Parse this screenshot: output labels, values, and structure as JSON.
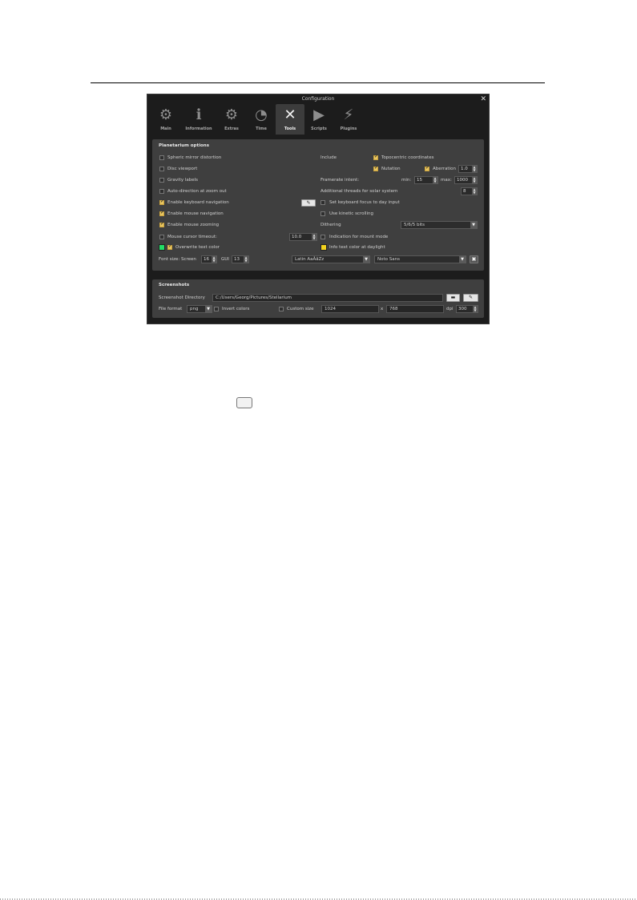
{
  "window": {
    "title": "Configuration",
    "close_glyph": "✕",
    "tabs": [
      {
        "label": "Main",
        "icon": "gear-icon",
        "glyph": "⚙"
      },
      {
        "label": "Information",
        "icon": "info-icon",
        "glyph": "ℹ"
      },
      {
        "label": "Extras",
        "icon": "extras-icon",
        "glyph": "⚙"
      },
      {
        "label": "Time",
        "icon": "clock-icon",
        "glyph": "◔"
      },
      {
        "label": "Tools",
        "icon": "tools-icon",
        "glyph": "✕"
      },
      {
        "label": "Scripts",
        "icon": "play-icon",
        "glyph": "▶"
      },
      {
        "label": "Plugins",
        "icon": "plug-icon",
        "glyph": "⚡"
      }
    ],
    "active_tab": "Tools"
  },
  "planetarium": {
    "title": "Planetarium options",
    "spheric_mirror": {
      "label": "Spheric mirror distortion",
      "checked": false
    },
    "disc_viewport": {
      "label": "Disc viewport",
      "checked": false
    },
    "gravity_labels": {
      "label": "Gravity labels",
      "checked": false
    },
    "auto_direction": {
      "label": "Auto-direction at zoom out",
      "checked": false
    },
    "keyboard_nav": {
      "label": "Enable keyboard navigation",
      "checked": true
    },
    "mouse_nav": {
      "label": "Enable mouse navigation",
      "checked": true
    },
    "mouse_zoom": {
      "label": "Enable mouse zooming",
      "checked": true
    },
    "mouse_timeout": {
      "label": "Mouse cursor timeout:",
      "checked": false,
      "value": "10.0"
    },
    "overwrite_color": {
      "label": "Overwrite text color",
      "checked": true,
      "color": "#22dd66"
    },
    "font_size": {
      "label": "Font size: Screen",
      "screen_value": "16",
      "gui_label": "GUI",
      "gui_value": "13"
    },
    "script_combo": "Latin  AaÂâZz",
    "include_label": "Include",
    "topocentric": {
      "label": "Topocentric coordinates",
      "checked": true
    },
    "nutation": {
      "label": "Nutation",
      "checked": true
    },
    "aberration": {
      "label": "Aberration",
      "checked": true,
      "value": "1.0"
    },
    "framerate": {
      "label": "Framerate intent:",
      "min_label": "min:",
      "min_value": "15",
      "max_label": "max:",
      "max_value": "1000"
    },
    "threads": {
      "label": "Additional threads for solar system",
      "value": "8"
    },
    "focus_day": {
      "label": "Set keyboard focus to day input",
      "checked": false
    },
    "kinetic": {
      "label": "Use kinetic scrolling",
      "checked": false
    },
    "dithering": {
      "label": "Dithering",
      "value": "5/6/5 bits"
    },
    "mount_mode": {
      "label": "Indication for mount mode",
      "checked": false
    },
    "daylight_color": {
      "label": "Info text color at daylight",
      "color": "#f2d21e"
    },
    "font_combo": "Noto Sans"
  },
  "screenshots": {
    "title": "Screenshots",
    "dir_label": "Screenshot Directory",
    "dir_value": "C:/Users/Georg/Pictures/Stellarium",
    "format_label": "File format",
    "format_value": "png",
    "invert": {
      "label": "Invert colors",
      "checked": false
    },
    "custom": {
      "label": "Custom size",
      "checked": false
    },
    "width": "1024",
    "x_sep": "x",
    "height": "768",
    "dpi_label": "dpi",
    "dpi_value": "300"
  },
  "colors": {
    "accent": "#e8c560",
    "window_bg": "#1c1c1c",
    "panel_bg": "#3f3f3f"
  }
}
